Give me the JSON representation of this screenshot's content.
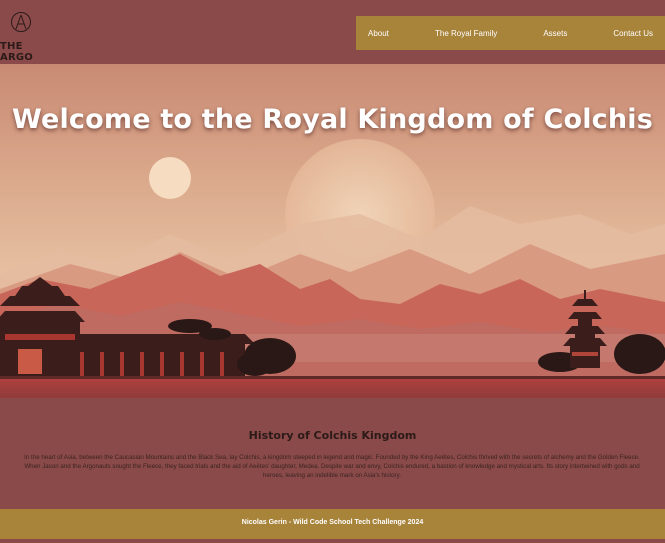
{
  "header": {
    "logo_text": "THE ARGO",
    "nav": [
      {
        "label": "About"
      },
      {
        "label": "The Royal Family"
      },
      {
        "label": "Assets"
      },
      {
        "label": "Contact Us"
      }
    ]
  },
  "hero": {
    "title": "Welcome to the Royal Kingdom of Colchis"
  },
  "history": {
    "title": "History of Colchis Kingdom",
    "text": "In the heart of Asia, between the Caucasian Mountains and the Black Sea, lay Colchis, a kingdom steeped in legend and magic. Founded by the King Aeëtes, Colchis thrived with the secrets of alchemy and the Golden Fleece. When Jason and the Argonauts sought the Fleece, they faced trials and the aid of Aeëtes' daughter, Medea. Despite war and envy, Colchis endured, a bastion of knowledge and mystical arts. Its story intertwined with gods and heroes, leaving an indelible mark on Asia's history."
  },
  "footer": {
    "text": "Nicolas Gerin - Wild Code School Tech Challenge 2024"
  },
  "colors": {
    "page_bg": "#8a4a4a",
    "gold": "#a8833a",
    "dark_text": "#2b1a17"
  }
}
